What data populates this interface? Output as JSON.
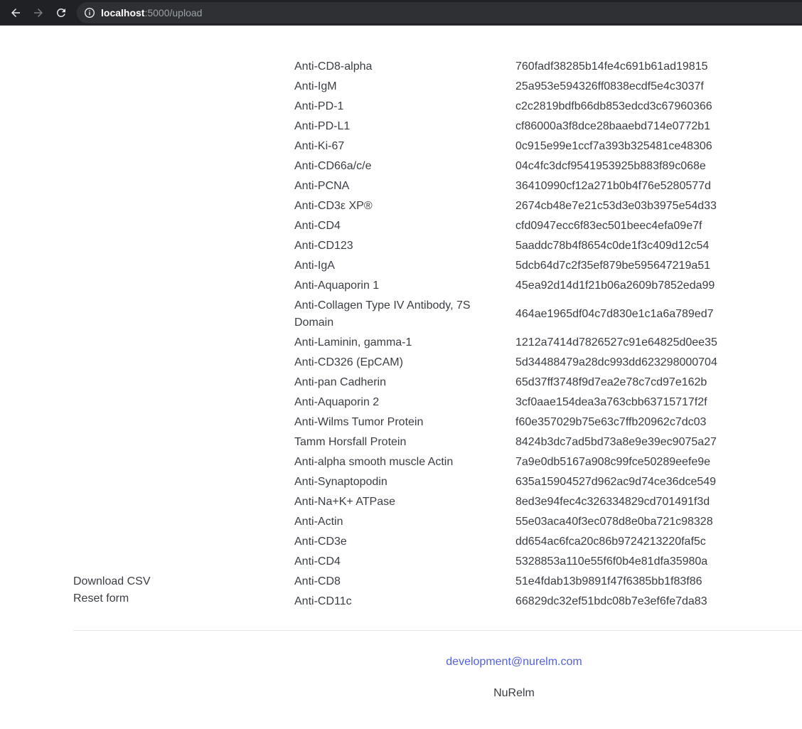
{
  "browser": {
    "url_host": "localhost",
    "url_path": ":5000/upload"
  },
  "rows": [
    {
      "name": "Anti-CD8-alpha",
      "hash": "760fadf38285b14fe4c691b61ad19815"
    },
    {
      "name": "Anti-IgM",
      "hash": "25a953e594326ff0838ecdf5e4c3037f"
    },
    {
      "name": "Anti-PD-1",
      "hash": "c2c2819bdfb66db853edcd3c67960366"
    },
    {
      "name": "Anti-PD-L1",
      "hash": "cf86000a3f8dce28baaebd714e0772b1"
    },
    {
      "name": "Anti-Ki-67",
      "hash": "0c915e99e1ccf7a393b325481ce48306"
    },
    {
      "name": "Anti-CD66a/c/e",
      "hash": "04c4fc3dcf9541953925b883f89c068e"
    },
    {
      "name": "Anti-PCNA",
      "hash": "36410990cf12a271b0b4f76e5280577d"
    },
    {
      "name": "Anti-CD3ε XP®",
      "hash": "2674cb48e7e21c53d3e03b3975e54d33"
    },
    {
      "name": "Anti-CD4",
      "hash": "cfd0947ecc6f83ec501beec4efa09e7f"
    },
    {
      "name": "Anti-CD123",
      "hash": "5aaddc78b4f8654c0de1f3c409d12c54"
    },
    {
      "name": "Anti-IgA",
      "hash": "5dcb64d7c2f35ef879be595647219a51"
    },
    {
      "name": "Anti-Aquaporin 1",
      "hash": "45ea92d14d1f21b06a2609b7852eda99"
    },
    {
      "name": "Anti-Collagen Type IV Antibody, 7S Domain",
      "hash": "464ae1965df04c7d830e1c1a6a789ed7"
    },
    {
      "name": "Anti-Laminin, gamma-1",
      "hash": "1212a7414d7826527c91e64825d0ee35"
    },
    {
      "name": "Anti-CD326 (EpCAM)",
      "hash": "5d34488479a28dc993dd623298000704"
    },
    {
      "name": "Anti-pan Cadherin",
      "hash": "65d37ff3748f9d7ea2e78c7cd97e162b"
    },
    {
      "name": "Anti-Aquaporin 2",
      "hash": "3cf0aae154dea3a763cbb63715717f2f"
    },
    {
      "name": "Anti-Wilms Tumor Protein",
      "hash": "f60e357029b75e63c7ffb20962c7dc03"
    },
    {
      "name": "Tamm Horsfall Protein",
      "hash": "8424b3dc7ad5bd73a8e9e39ec9075a27"
    },
    {
      "name": "Anti-alpha smooth muscle Actin",
      "hash": "7a9e0db5167a908c99fce50289eefe9e"
    },
    {
      "name": "Anti-Synaptopodin",
      "hash": "635a15904527d962ac9d74ce36dce549"
    },
    {
      "name": "Anti-Na+K+ ATPase",
      "hash": "8ed3e94fec4c326334829cd701491f3d"
    },
    {
      "name": "Anti-Actin",
      "hash": "55e03aca40f3ec078d8e0ba721c98328"
    },
    {
      "name": "Anti-CD3e",
      "hash": "dd654ac6fca20c86b9724213220faf5c"
    },
    {
      "name": "Anti-CD4",
      "hash": "5328853a110e55f6f0b4e81dfa35980a"
    },
    {
      "name": "Anti-CD8",
      "hash": "51e4fdab13b9891f47f6385bb1f83f86"
    },
    {
      "name": "Anti-CD11c",
      "hash": "66829dc32ef51bdc08b7e3ef6fe7da83"
    }
  ],
  "actions": {
    "download_label": "Download CSV",
    "reset_label": "Reset form"
  },
  "footer": {
    "email": "development@nurelm.com",
    "brand": "NuRelm"
  }
}
